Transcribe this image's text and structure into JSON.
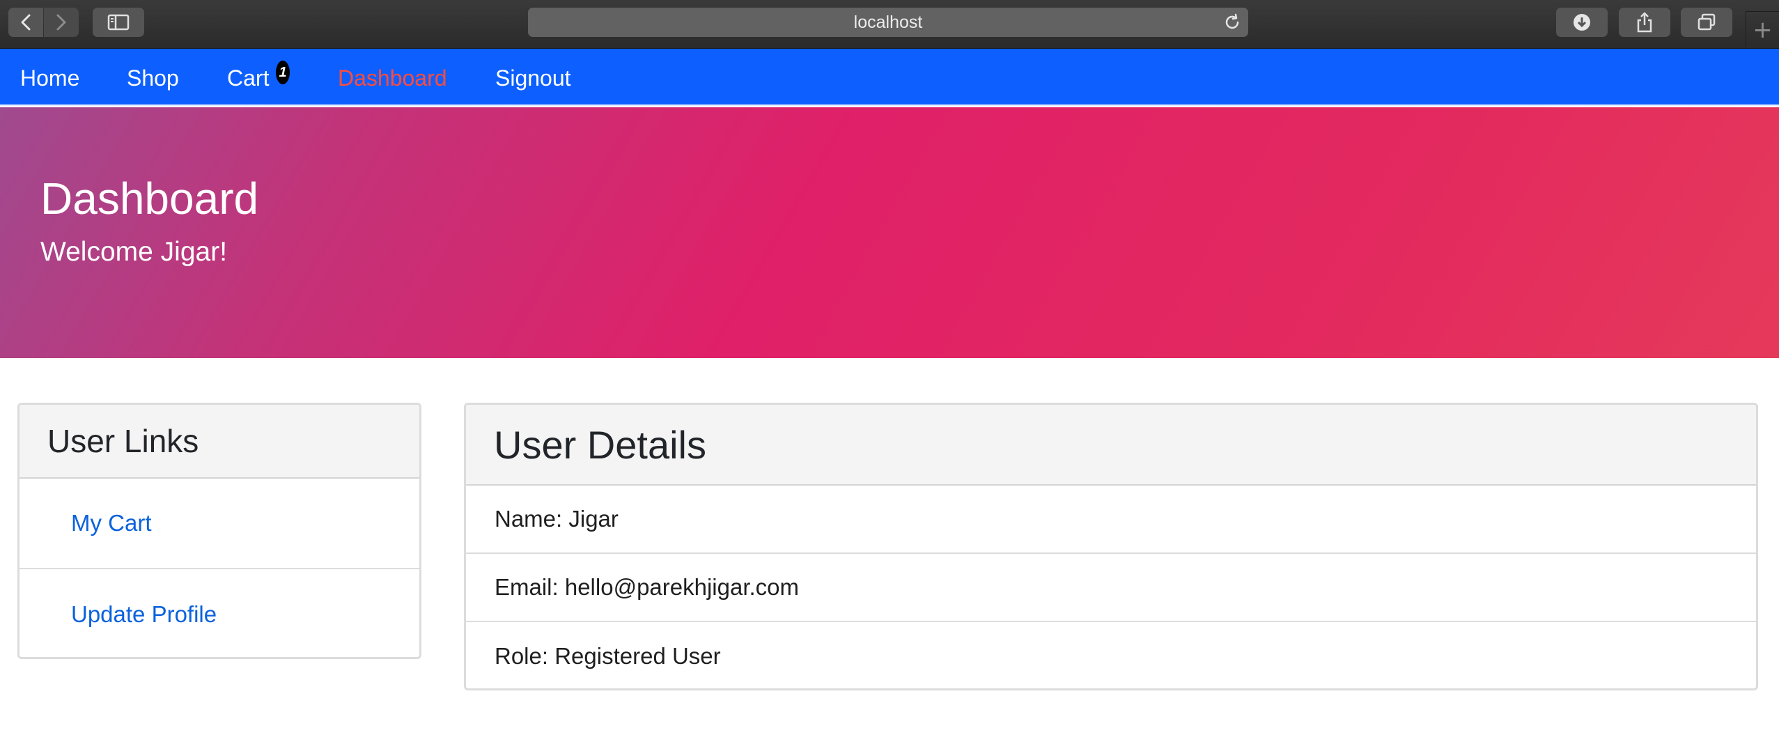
{
  "browser": {
    "url": "localhost",
    "icons": [
      "chevron-left-icon",
      "chevron-right-icon",
      "sidebar-icon",
      "reload-icon",
      "download-icon",
      "share-icon",
      "tabs-icon",
      "plus-icon"
    ],
    "new_tab_label": "+"
  },
  "navbar": {
    "color": "#0d60ff",
    "active_color": "#ff4b3e",
    "links": {
      "home": "Home",
      "shop": "Shop",
      "cart": "Cart",
      "dashboard": "Dashboard",
      "signout": "Signout"
    },
    "cart_count": "1"
  },
  "jumbotron": {
    "title": "Dashboard",
    "subtitle": "Welcome Jigar!"
  },
  "user_links": {
    "title": "User Links",
    "items": [
      "My Cart",
      "Update Profile"
    ]
  },
  "user_details": {
    "title": "User Details",
    "rows": [
      "Name: Jigar",
      "Email: hello@parekhjigar.com",
      "Role: Registered User"
    ]
  }
}
